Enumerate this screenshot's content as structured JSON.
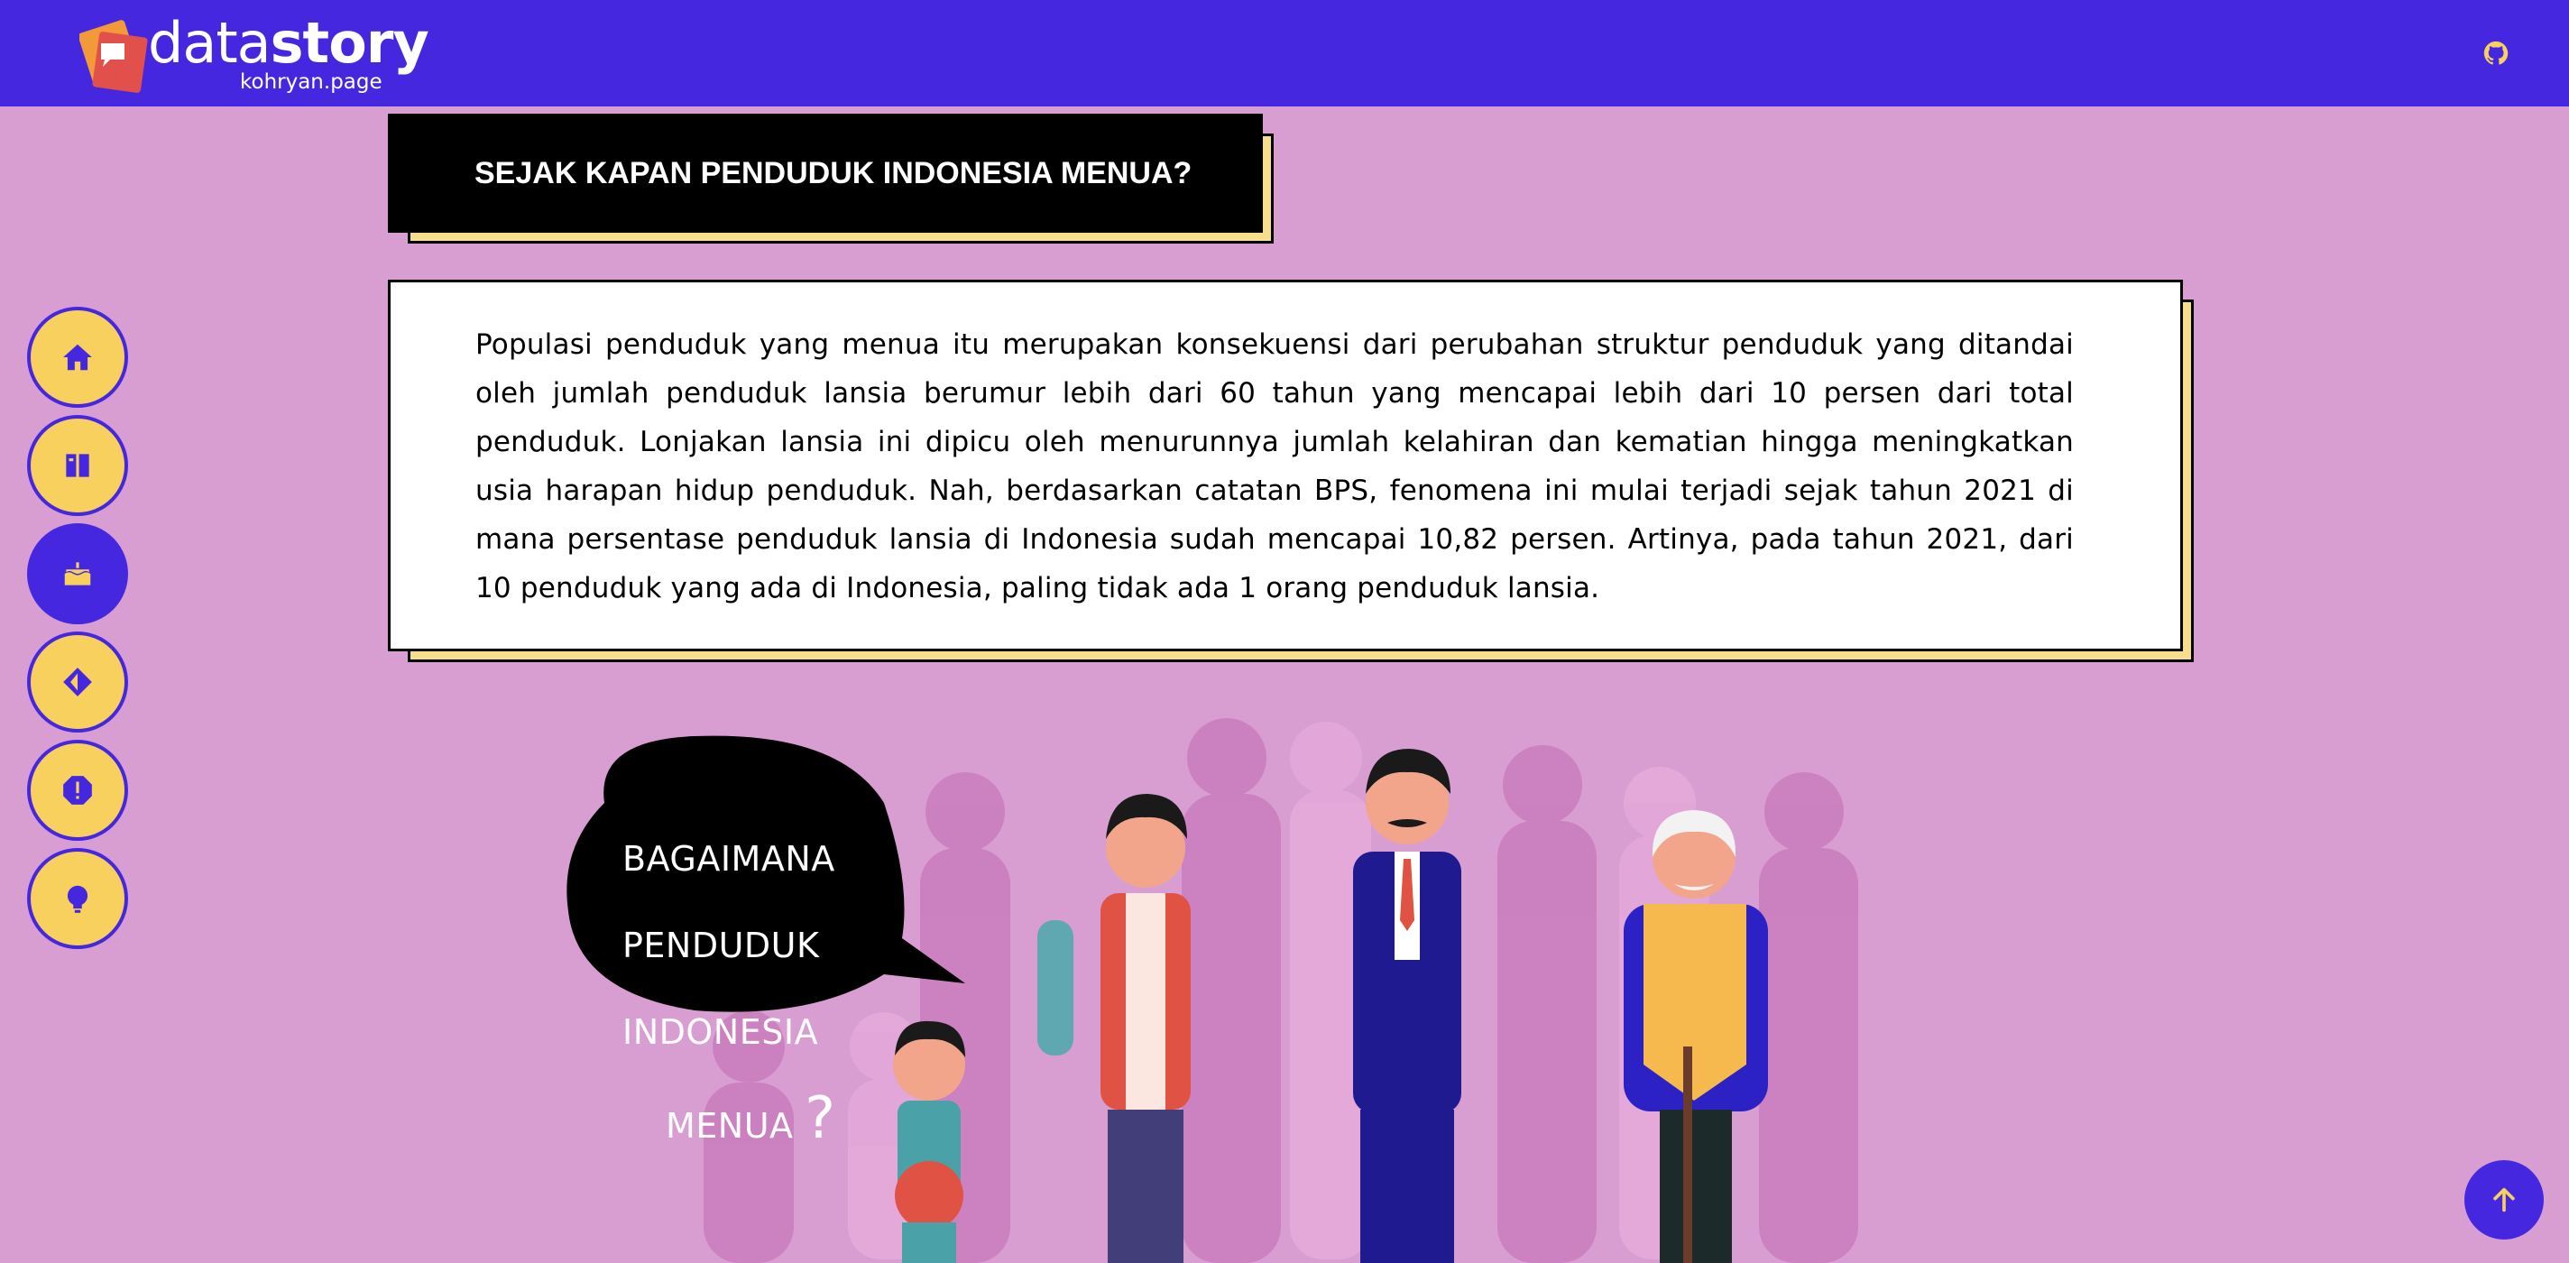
{
  "header": {
    "logo_main": "data",
    "logo_bold": "story",
    "logo_sub": "kohryan.page",
    "github_icon": "github-icon"
  },
  "colors": {
    "primary": "#4527e0",
    "background": "#d99ed1",
    "accent": "#f8d05e",
    "shadow": "#f6de8c"
  },
  "sidenav": {
    "items": [
      {
        "icon": "home-icon",
        "active": false
      },
      {
        "icon": "book-icon",
        "active": false
      },
      {
        "icon": "cake-icon",
        "active": true
      },
      {
        "icon": "compass-icon",
        "active": false
      },
      {
        "icon": "alert-icon",
        "active": false
      },
      {
        "icon": "lightbulb-icon",
        "active": false
      }
    ]
  },
  "section": {
    "title": "SEJAK KAPAN PENDUDUK INDONESIA MENUA?",
    "paragraph": "Populasi penduduk yang menua itu merupakan konsekuensi dari perubahan struktur penduduk yang ditandai oleh jumlah penduduk lansia berumur lebih dari 60 tahun yang mencapai lebih dari 10 persen dari total penduduk. Lonjakan lansia ini dipicu oleh menurunnya jumlah kelahiran dan kematian hingga meningkatkan usia harapan hidup penduduk. Nah, berdasarkan catatan BPS, fenomena ini mulai terjadi sejak tahun 2021 di mana persentase penduduk lansia di Indonesia sudah mencapai 10,82 persen. Artinya, pada tahun 2021, dari 10 penduduk yang ada di Indonesia, paling tidak ada 1 orang penduduk lansia."
  },
  "illustration": {
    "bubble_line1": "BAGAIMANA",
    "bubble_line2": "PENDUDUK",
    "bubble_line3": "INDONESIA",
    "bubble_line4": "MENUA",
    "bubble_mark": "?"
  },
  "scroll_top_icon": "arrow-up-icon"
}
